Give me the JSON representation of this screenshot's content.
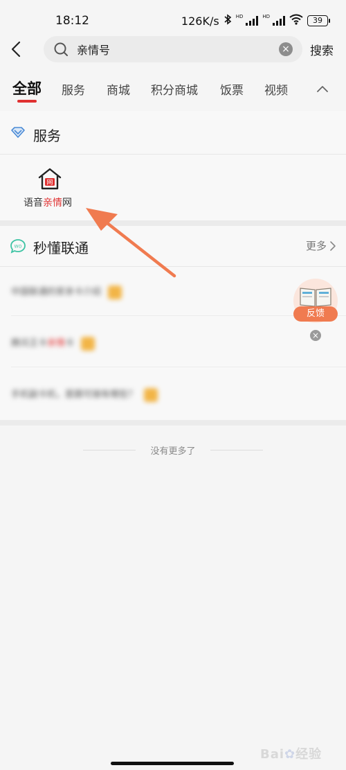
{
  "status_bar": {
    "time": "18:12",
    "net_speed": "126K/s",
    "hd_label": "HD",
    "battery": "39"
  },
  "header": {
    "search_value": "亲情号",
    "search_button": "搜索"
  },
  "tabs": [
    {
      "label": "全部",
      "active": true
    },
    {
      "label": "服务"
    },
    {
      "label": "商城"
    },
    {
      "label": "积分商城"
    },
    {
      "label": "饭票"
    },
    {
      "label": "视频"
    }
  ],
  "service_section": {
    "title": "服务",
    "item": {
      "icon_text": "网",
      "label_pre": "语音",
      "label_hl": "亲情",
      "label_post": "网"
    }
  },
  "news_section": {
    "title": "秒懂联通",
    "wo_icon_text": "WO",
    "more": "更多",
    "rows": [
      {
        "text": "中国联通的家亲卡介绍"
      },
      {
        "text_pre": "腾讯王卡",
        "text_hl": "亲情",
        "text_post": "卡"
      },
      {
        "text": "手机副卡机，是跟可接有哪些？"
      }
    ]
  },
  "feedback": {
    "label": "反馈"
  },
  "footer": {
    "end_text": "没有更多了",
    "watermark_a": "Bai",
    "watermark_b": "经验"
  },
  "colors": {
    "accent_red": "#e03131",
    "arrow_orange": "#f07b50",
    "tag_yellow": "#f2b547"
  }
}
